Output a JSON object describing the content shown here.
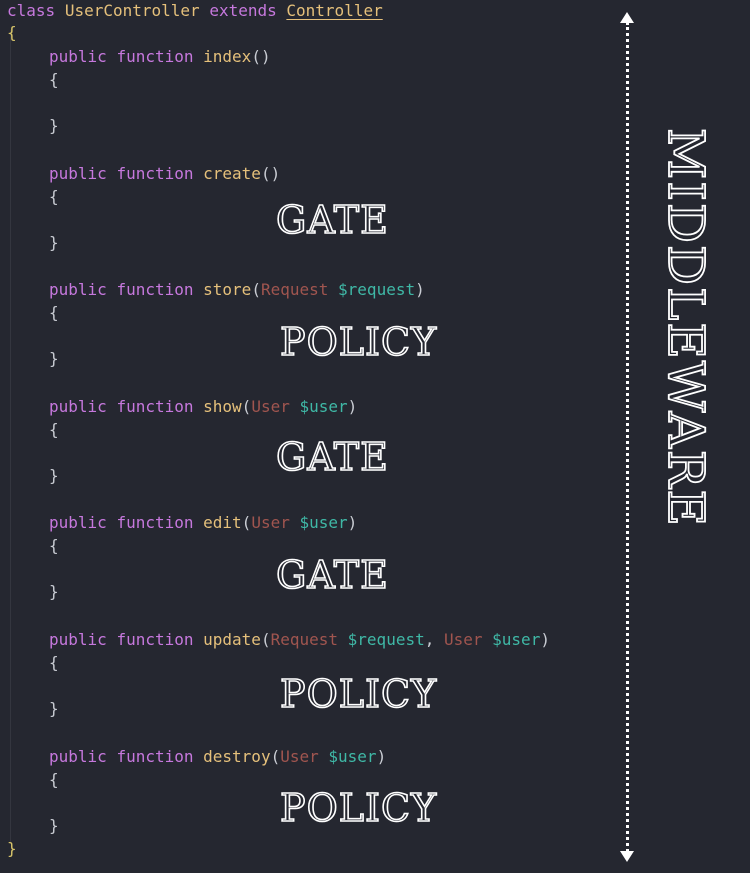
{
  "class_decl": {
    "kw_class": "class",
    "name": "UserController",
    "kw_extends": "extends",
    "parent": "Controller"
  },
  "braces": {
    "open": "{",
    "close": "}"
  },
  "methods": [
    {
      "kw_public": "public",
      "kw_function": "function",
      "name": "index",
      "open_paren": "(",
      "params": [],
      "close_paren": ")",
      "open_brace": "{",
      "close_brace": "}"
    },
    {
      "kw_public": "public",
      "kw_function": "function",
      "name": "create",
      "open_paren": "(",
      "params": [],
      "close_paren": ")",
      "open_brace": "{",
      "close_brace": "}"
    },
    {
      "kw_public": "public",
      "kw_function": "function",
      "name": "store",
      "open_paren": "(",
      "params": [
        {
          "type": "Request",
          "var": "$request"
        }
      ],
      "close_paren": ")",
      "open_brace": "{",
      "close_brace": "}"
    },
    {
      "kw_public": "public",
      "kw_function": "function",
      "name": "show",
      "open_paren": "(",
      "params": [
        {
          "type": "User",
          "var": "$user"
        }
      ],
      "close_paren": ")",
      "open_brace": "{",
      "close_brace": "}"
    },
    {
      "kw_public": "public",
      "kw_function": "function",
      "name": "edit",
      "open_paren": "(",
      "params": [
        {
          "type": "User",
          "var": "$user"
        }
      ],
      "close_paren": ")",
      "open_brace": "{",
      "close_brace": "}"
    },
    {
      "kw_public": "public",
      "kw_function": "function",
      "name": "update",
      "open_paren": "(",
      "params": [
        {
          "type": "Request",
          "var": "$request"
        },
        {
          "type": "User",
          "var": "$user"
        }
      ],
      "close_paren": ")",
      "open_brace": "{",
      "close_brace": "}"
    },
    {
      "kw_public": "public",
      "kw_function": "function",
      "name": "destroy",
      "open_paren": "(",
      "params": [
        {
          "type": "User",
          "var": "$user"
        }
      ],
      "close_paren": ")",
      "open_brace": "{",
      "close_brace": "}"
    }
  ],
  "param_separator": ", ",
  "labels": [
    "GATE",
    "POLICY",
    "GATE",
    "GATE",
    "POLICY",
    "POLICY"
  ],
  "middleware_label": "MIDDLEWARE",
  "colors": {
    "background": "#252730",
    "keyword": "#c678dd",
    "name": "#e5c07b",
    "type": "#a0554f",
    "variable": "#3fb8a6",
    "text": "#c9ccd3",
    "brace": "#d7c46a",
    "outline": "#ffffff"
  }
}
